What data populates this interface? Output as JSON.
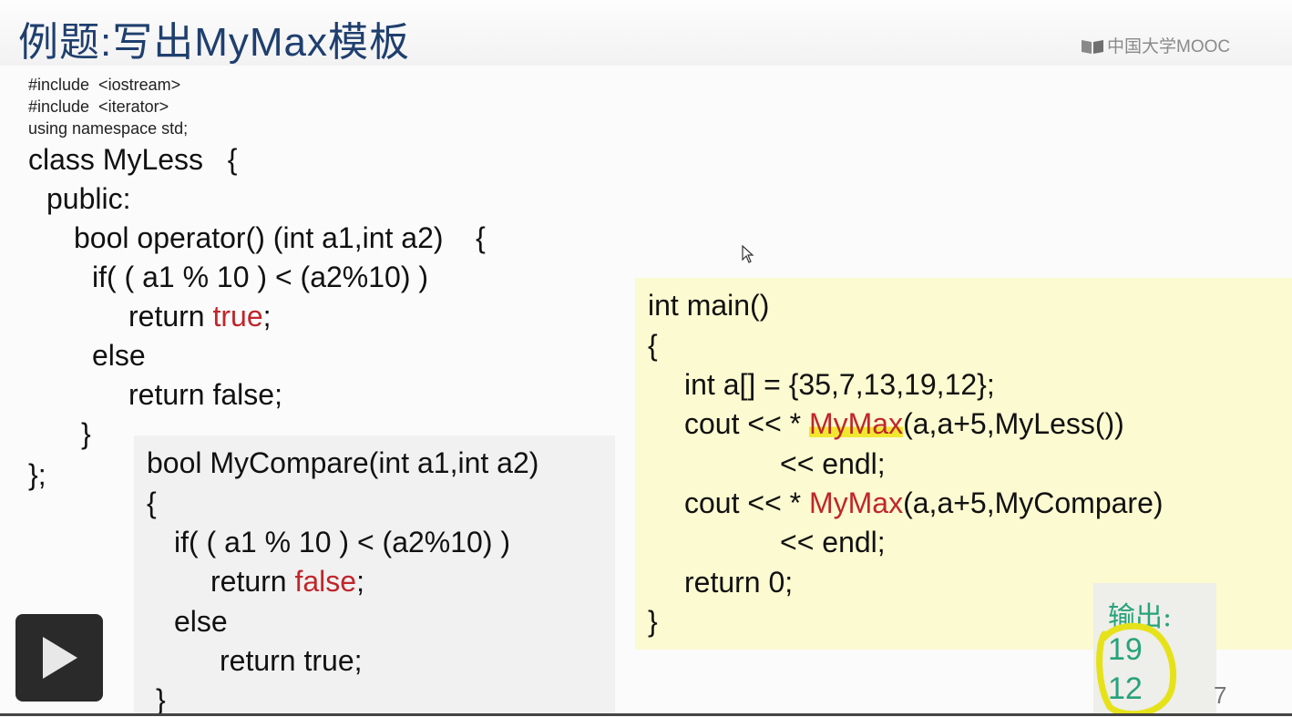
{
  "slide": {
    "title": "例题:写出MyMax模板",
    "brand": "中国大学MOOC",
    "page_number": "7"
  },
  "left_code": {
    "includes": [
      "#include  <iostream>",
      "#include  <iterator>",
      "using namespace std;"
    ],
    "class_header": "class MyLess   {",
    "public": "public:",
    "operator_line": "bool operator() (int a1,int a2)    {",
    "if_line": "if( ( a1 % 10 ) < (a2%10) )",
    "return_true_prefix": "return ",
    "return_true_kw": "true",
    "return_true_suffix": ";",
    "else": "else",
    "return_false": "return false;",
    "close_brace": "}",
    "class_end": "};"
  },
  "compare_code": {
    "header": "bool MyCompare(int a1,int a2)",
    "open": "{",
    "if_line": "if( ( a1 % 10 ) < (a2%10) )",
    "return_false_prefix": "return ",
    "return_false_kw": "false",
    "return_false_suffix": ";",
    "else": "else",
    "return_true": "return true;",
    "close": "}"
  },
  "main_code": {
    "header": "int main()",
    "open": "{",
    "array": "int a[] = {35,7,13,19,12};",
    "cout1_prefix": "cout << * ",
    "cout1_fn": "MyMax",
    "cout1_args": "(a,a+5,MyLess())",
    "endl1": "<< endl;",
    "cout2_prefix": "cout << * ",
    "cout2_fn": "MyMax",
    "cout2_args": "(a,a+5,MyCompare)",
    "endl2": "<< endl;",
    "return": "return 0;",
    "close": "}"
  },
  "output": {
    "label": "输出:",
    "values": [
      "19",
      "12"
    ]
  },
  "icons": {
    "play": "play-icon",
    "cursor": "mouse-cursor-icon"
  },
  "colors": {
    "title": "#1f3f6e",
    "keyword_red": "#c0262b",
    "main_box_bg": "#fcfad0",
    "output_green": "#27a37b",
    "highlight": "#f0e830"
  }
}
